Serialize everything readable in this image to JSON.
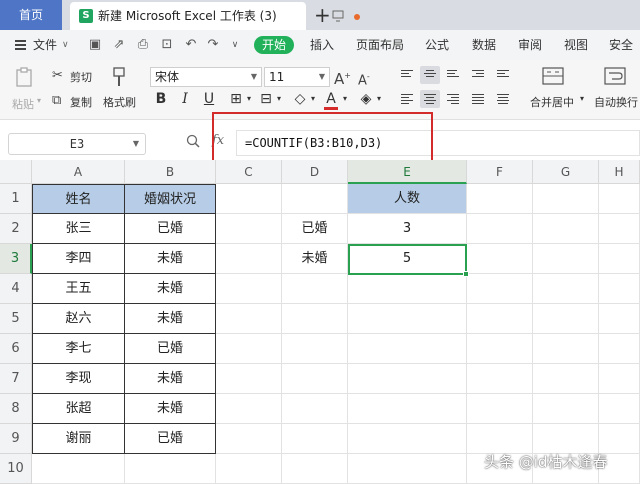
{
  "tabs": {
    "home": "首页",
    "document": "新建 Microsoft Excel 工作表 (3)",
    "add": "+"
  },
  "menu": {
    "file": "文件",
    "start": "开始",
    "insert": "插入",
    "page_layout": "页面布局",
    "formulas": "公式",
    "data": "数据",
    "review": "审阅",
    "view": "视图",
    "security": "安全"
  },
  "ribbon": {
    "paste": "粘贴",
    "cut": "剪切",
    "copy": "复制",
    "format_painter": "格式刷",
    "font_name": "宋体",
    "font_size": "11",
    "merge_center": "合并居中",
    "auto_wrap": "自动换行"
  },
  "formula_bar": {
    "name_box": "E3",
    "fx": "fx",
    "formula": "=COUNTIF(B3:B10,D3)"
  },
  "columns": [
    "A",
    "B",
    "C",
    "D",
    "E",
    "F",
    "G",
    "H"
  ],
  "rows": [
    "1",
    "2",
    "3",
    "4",
    "5",
    "6",
    "7",
    "8",
    "9",
    "10"
  ],
  "table": {
    "header_name": "姓名",
    "header_status": "婚姻状况",
    "names": [
      "张三",
      "李四",
      "王五",
      "赵六",
      "李七",
      "李现",
      "张超",
      "谢丽"
    ],
    "statuses": [
      "已婚",
      "未婚",
      "未婚",
      "未婚",
      "已婚",
      "未婚",
      "未婚",
      "已婚"
    ]
  },
  "summary": {
    "header_count": "人数",
    "labels": [
      "已婚",
      "未婚"
    ],
    "counts": [
      "3",
      "5"
    ]
  },
  "selected_cell": "E3",
  "watermark": "头条 @id枯木逢春",
  "colors": {
    "home_tab": "#4f76c6",
    "start_button": "#20b15a",
    "header_fill": "#b7cde7",
    "selection": "#2aa150",
    "highlight_box": "#d32a2a"
  }
}
